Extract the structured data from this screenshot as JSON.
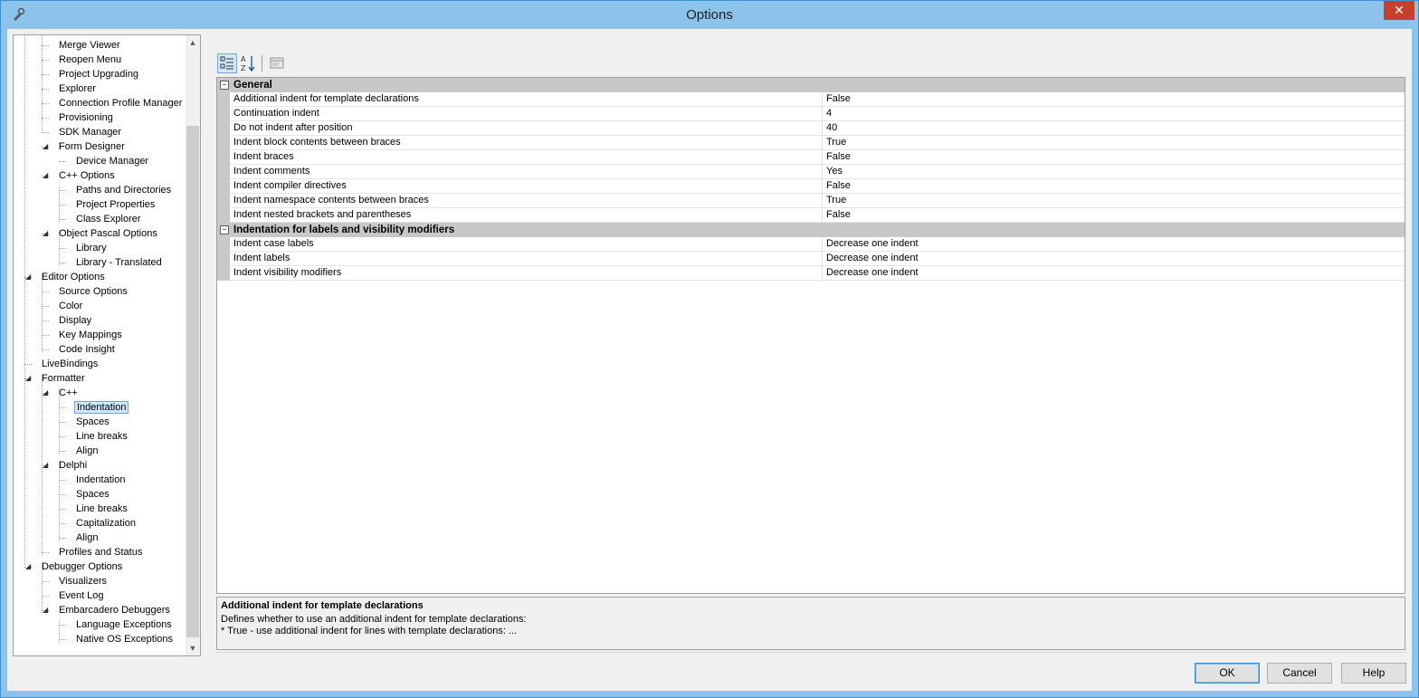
{
  "window": {
    "title": "Options",
    "close_glyph": "✕"
  },
  "tree": [
    {
      "label": "Merge Viewer",
      "level": 1
    },
    {
      "label": "Reopen Menu",
      "level": 1
    },
    {
      "label": "Project Upgrading",
      "level": 1
    },
    {
      "label": "Explorer",
      "level": 1
    },
    {
      "label": "Connection Profile Manager",
      "level": 1
    },
    {
      "label": "Provisioning",
      "level": 1
    },
    {
      "label": "SDK Manager",
      "level": 1
    },
    {
      "label": "Form Designer",
      "level": 1,
      "expanded": true
    },
    {
      "label": "Device Manager",
      "level": 2
    },
    {
      "label": "C++ Options",
      "level": 1,
      "expanded": true
    },
    {
      "label": "Paths and Directories",
      "level": 2
    },
    {
      "label": "Project Properties",
      "level": 2
    },
    {
      "label": "Class Explorer",
      "level": 2
    },
    {
      "label": "Object Pascal Options",
      "level": 1,
      "expanded": true
    },
    {
      "label": "Library",
      "level": 2
    },
    {
      "label": "Library - Translated",
      "level": 2
    },
    {
      "label": "Editor Options",
      "level": 0,
      "expanded": true
    },
    {
      "label": "Source Options",
      "level": 1
    },
    {
      "label": "Color",
      "level": 1
    },
    {
      "label": "Display",
      "level": 1
    },
    {
      "label": "Key Mappings",
      "level": 1
    },
    {
      "label": "Code Insight",
      "level": 1
    },
    {
      "label": "LiveBindings",
      "level": 0
    },
    {
      "label": "Formatter",
      "level": 0,
      "expanded": true
    },
    {
      "label": "C++",
      "level": 1,
      "expanded": true
    },
    {
      "label": "Indentation",
      "level": 2,
      "selected": true
    },
    {
      "label": "Spaces",
      "level": 2
    },
    {
      "label": "Line breaks",
      "level": 2
    },
    {
      "label": "Align",
      "level": 2
    },
    {
      "label": "Delphi",
      "level": 1,
      "expanded": true
    },
    {
      "label": "Indentation",
      "level": 2
    },
    {
      "label": "Spaces",
      "level": 2
    },
    {
      "label": "Line breaks",
      "level": 2
    },
    {
      "label": "Capitalization",
      "level": 2
    },
    {
      "label": "Align",
      "level": 2
    },
    {
      "label": "Profiles and Status",
      "level": 1
    },
    {
      "label": "Debugger Options",
      "level": 0,
      "expanded": true
    },
    {
      "label": "Visualizers",
      "level": 1
    },
    {
      "label": "Event Log",
      "level": 1
    },
    {
      "label": "Embarcadero Debuggers",
      "level": 1,
      "expanded": true
    },
    {
      "label": "Language Exceptions",
      "level": 2
    },
    {
      "label": "Native OS Exceptions",
      "level": 2
    }
  ],
  "scrollbar": {
    "up_glyph": "▲",
    "down_glyph": "▼"
  },
  "toolbar": {
    "sort_az_label": "A Z"
  },
  "categories": [
    {
      "name": "General",
      "collapse_glyph": "−",
      "props": [
        {
          "name": "Additional indent for template declarations",
          "value": "False"
        },
        {
          "name": "Continuation indent",
          "value": "4"
        },
        {
          "name": "Do not indent after position",
          "value": "40"
        },
        {
          "name": "Indent block contents between braces",
          "value": "True"
        },
        {
          "name": "Indent braces",
          "value": "False"
        },
        {
          "name": "Indent comments",
          "value": "Yes"
        },
        {
          "name": "Indent compiler directives",
          "value": "False"
        },
        {
          "name": "Indent namespace contents between braces",
          "value": "True"
        },
        {
          "name": "Indent nested brackets and parentheses",
          "value": "False"
        }
      ]
    },
    {
      "name": "Indentation for labels and visibility modifiers",
      "collapse_glyph": "−",
      "props": [
        {
          "name": "Indent case labels",
          "value": "Decrease one indent"
        },
        {
          "name": "Indent labels",
          "value": "Decrease one indent"
        },
        {
          "name": "Indent visibility modifiers",
          "value": "Decrease one indent"
        }
      ]
    }
  ],
  "description": {
    "title": "Additional indent for template declarations",
    "line1": "Defines whether to use an additional indent for template declarations:",
    "line2": "* True - use additional indent for lines with template declarations: ..."
  },
  "buttons": {
    "ok": "OK",
    "cancel": "Cancel",
    "help": "Help"
  },
  "colors": {
    "titlebar": "#8cc3ea",
    "close": "#c7402e",
    "selection": "#cce8ff",
    "category": "#c8c8c8"
  }
}
